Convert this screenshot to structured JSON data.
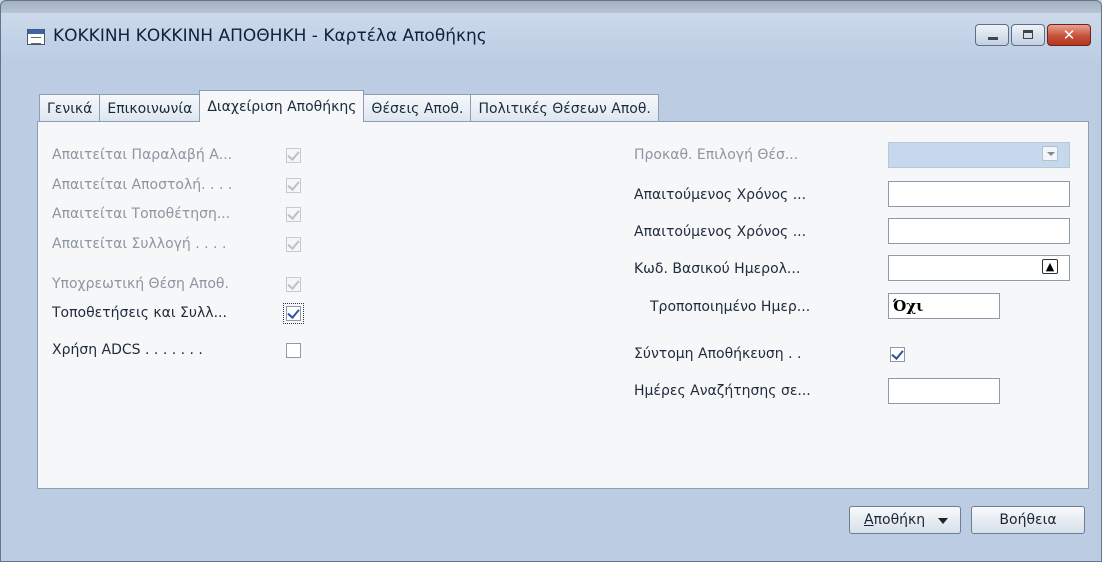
{
  "window": {
    "title": "ΚΟΚΚΙΝΗ ΚΟΚΚΙΝΗ ΑΠΟΘΗΚΗ - Καρτέλα Αποθήκης",
    "icon": "card-icon",
    "controls": {
      "minimize": "minimize-icon",
      "maximize": "maximize-icon",
      "close": "close-icon",
      "close_glyph": "✕"
    }
  },
  "tabs": [
    {
      "label": "Γενικά",
      "active": false
    },
    {
      "label": "Επικοινωνία",
      "active": false
    },
    {
      "label": "Διαχείριση Αποθήκης",
      "active": true
    },
    {
      "label": "Θέσεις Αποθ.",
      "active": false
    },
    {
      "label": "Πολιτικές Θέσεων Αποθ.",
      "active": false
    }
  ],
  "left_fields": [
    {
      "label": "Απαιτείται Παραλαβή Α...",
      "checked": true,
      "enabled": false
    },
    {
      "label": "Απαιτείται Αποστολή. . . .",
      "checked": true,
      "enabled": false
    },
    {
      "label": "Απαιτείται Τοποθέτηση...",
      "checked": true,
      "enabled": false
    },
    {
      "label": "Απαιτείται Συλλογή . . . .",
      "checked": true,
      "enabled": false
    },
    {
      "label": "Υποχρεωτική Θέση Αποθ.",
      "checked": true,
      "enabled": false
    },
    {
      "label": "Τοποθετήσεις και Συλλ...",
      "checked": true,
      "enabled": true
    },
    {
      "label": "Χρήση ADCS . . . . . . .",
      "checked": false,
      "enabled": true
    }
  ],
  "right_fields": {
    "default_bin_selection": {
      "label": "Προκαθ. Επιλογή Θέσ...",
      "value": ""
    },
    "required_time_1": {
      "label": "Απαιτούμενος Χρόνος ...",
      "value": ""
    },
    "required_time_2": {
      "label": "Απαιτούμενος Χρόνος ...",
      "value": ""
    },
    "base_calendar_code": {
      "label": "Κωδ. Βασικού Ημερολ...",
      "value": ""
    },
    "customized_calendar": {
      "label": "Τροποποιημένο Ημερ...",
      "value": "Όχι"
    },
    "express_put_away": {
      "label": "Σύντομη Αποθήκευση . .",
      "checked": true
    },
    "bin_search_days": {
      "label": "Ημέρες Αναζήτησης σε...",
      "value": ""
    }
  },
  "buttons": {
    "warehouse_prefix": "Α",
    "warehouse_rest": "ποθήκη",
    "help": "Βοήθεια"
  },
  "colors": {
    "window_bg": "#bccde3",
    "panel_bg": "#f5f7f9",
    "disabled_combo": "#c6d8ec",
    "check_mark": "#3253a6",
    "close_button": "#c7503a"
  }
}
